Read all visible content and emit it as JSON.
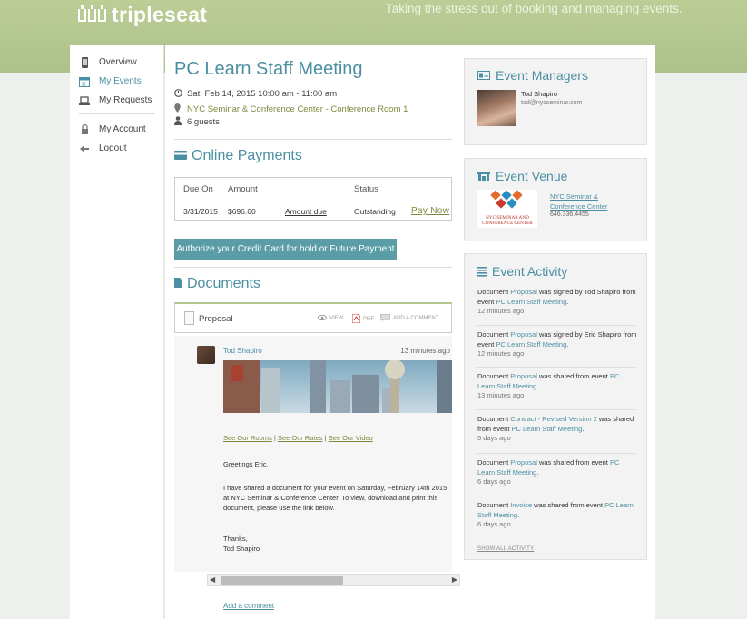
{
  "header": {
    "brand": "tripleseat",
    "tagline": "Taking the stress out of booking and managing events."
  },
  "sidebar": {
    "items": [
      {
        "label": "Overview",
        "icon": "phone-icon"
      },
      {
        "label": "My Events",
        "icon": "calendar-icon",
        "active": true
      },
      {
        "label": "My Requests",
        "icon": "laptop-icon"
      },
      {
        "label": "My Account",
        "icon": "lock-icon"
      },
      {
        "label": "Logout",
        "icon": "logout-arrow-icon"
      }
    ]
  },
  "event": {
    "title": "PC Learn Staff Meeting",
    "datetime": "Sat, Feb 14, 2015 10:00 am - 11:00 am",
    "location": "NYC Seminar & Conference Center - Conference Room 1",
    "guests": "6 guests"
  },
  "payments": {
    "heading": "Online Payments",
    "columns": [
      "Due On",
      "Amount",
      "Status"
    ],
    "rows": [
      {
        "due_on": "3/31/2015",
        "amount": "$696.60",
        "amount_link": "Amount due",
        "status": "Outstanding",
        "action": "Pay Now"
      }
    ],
    "authorize_label": "Authorize your Credit Card for hold or Future Payment"
  },
  "documents": {
    "heading": "Documents",
    "items": [
      {
        "name": "Proposal",
        "view": "VIEW",
        "pdf": "PDF",
        "add_comment": "ADD A COMMENT"
      }
    ],
    "comment": {
      "author": "Tod Shapiro",
      "time": "13 minutes ago",
      "links": [
        "See Our Rooms",
        "See Our Rates",
        "See Our Video"
      ],
      "separator": "|",
      "greeting": "Greetings Eric,",
      "body": "I have shared a document for your event on Saturday, February 14th 2015 at NYC Seminar & Conference Center. To view, download and print this document, please use the link below.",
      "signoff": "Thanks,",
      "signature": "Tod Shapiro"
    },
    "add_comment_link": "Add a comment"
  },
  "event_managers": {
    "heading": "Event Managers",
    "name": "Tod Shapiro",
    "email": "tod@nycseminar.com"
  },
  "event_venue": {
    "heading": "Event Venue",
    "name_line1": "NYC Seminar &",
    "name_line2": "Conference Center",
    "phone": "646.336.4455",
    "logo_text_1": "NYC SEMINAR AND",
    "logo_text_2": "CONFERENCE CENTER"
  },
  "event_activity": {
    "heading": "Event Activity",
    "items": [
      {
        "pre": "Document ",
        "link": "Proposal",
        "mid": " was signed by Tod Shapiro from event ",
        "event": "PC Learn Staff Meeting",
        "post": ".",
        "time": "12 minutes ago"
      },
      {
        "pre": "Document ",
        "link": "Proposal",
        "mid": " was signed by Eric Shapiro from event ",
        "event": "PC Learn Staff Meeting",
        "post": ".",
        "time": "12 minutes ago"
      },
      {
        "pre": "Document ",
        "link": "Proposal",
        "mid": " was shared from event ",
        "event": "PC Learn Staff Meeting",
        "post": ".",
        "time": "13 minutes ago"
      },
      {
        "pre": "Document ",
        "link": "Contract - Revised Version 2",
        "mid": " was shared from event ",
        "event": "PC Learn Staff Meeting",
        "post": ".",
        "time": "5 days ago"
      },
      {
        "pre": "Document ",
        "link": "Proposal",
        "mid": " was shared from event ",
        "event": "PC Learn Staff Meeting",
        "post": ".",
        "time": "6 days ago"
      },
      {
        "pre": "Document ",
        "link": "Invoice",
        "mid": " was shared from event ",
        "event": "PC Learn Staff Meeting",
        "post": ".",
        "time": "6 days ago"
      }
    ],
    "show_all": "SHOW ALL ACTIVITY"
  },
  "colors": {
    "header_bg": "#aec18a",
    "accent": "#4a8fa3",
    "button": "#5b9da7"
  }
}
